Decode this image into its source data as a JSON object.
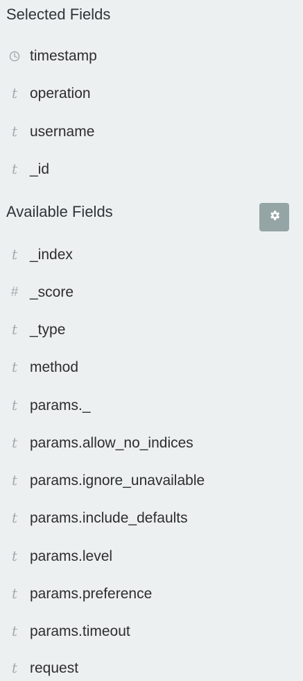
{
  "selected": {
    "title": "Selected Fields",
    "fields": [
      {
        "type_icon": "clock-icon",
        "name": "timestamp"
      },
      {
        "type_icon": "t",
        "name": "operation"
      },
      {
        "type_icon": "t",
        "name": "username"
      },
      {
        "type_icon": "t",
        "name": "_id"
      }
    ]
  },
  "available": {
    "title": "Available Fields",
    "settings_icon": "gear-icon",
    "fields": [
      {
        "type_icon": "t",
        "name": "_index"
      },
      {
        "type_icon": "#",
        "name": "_score"
      },
      {
        "type_icon": "t",
        "name": "_type"
      },
      {
        "type_icon": "t",
        "name": "method"
      },
      {
        "type_icon": "t",
        "name": "params._"
      },
      {
        "type_icon": "t",
        "name": "params.allow_no_indices"
      },
      {
        "type_icon": "t",
        "name": "params.ignore_unavailable"
      },
      {
        "type_icon": "t",
        "name": "params.include_defaults"
      },
      {
        "type_icon": "t",
        "name": "params.level"
      },
      {
        "type_icon": "t",
        "name": "params.preference"
      },
      {
        "type_icon": "t",
        "name": "params.timeout"
      },
      {
        "type_icon": "t",
        "name": "request"
      }
    ]
  },
  "colors": {
    "background": "#ecf0f1",
    "icon_gray": "#a7aaad",
    "gear_button": "#95a5a6"
  }
}
